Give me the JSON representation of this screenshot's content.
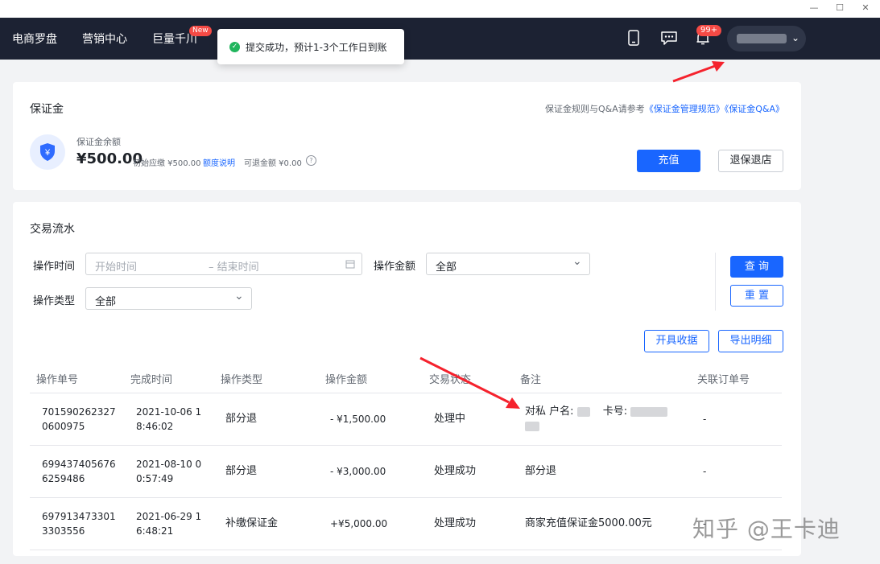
{
  "nav": {
    "items": [
      "电商罗盘",
      "营销中心",
      "巨量千川"
    ],
    "new_badge": "New",
    "notif_count": "99+"
  },
  "toast": {
    "message": "提交成功，预计1-3个工作日到账"
  },
  "deposit": {
    "title": "保证金",
    "rules_prefix": "保证金规则与Q&A请参考",
    "rules_link1": "《保证金管理规范》",
    "rules_link2": "《保证金Q&A》",
    "balance_label": "保证金余额",
    "balance": "¥500.00",
    "initial_due": "初始应缴 ¥500.00",
    "quota_link": "额度说明",
    "refundable": "可退金额 ¥0.00",
    "recharge_button": "充值",
    "refund_button": "退保退店"
  },
  "transactions": {
    "title": "交易流水",
    "filters": {
      "time_label": "操作时间",
      "start_placeholder": "开始时间",
      "end_placeholder": "– 结束时间",
      "amount_label": "操作金额",
      "amount_value": "全部",
      "type_label": "操作类型",
      "type_value": "全部",
      "query_button": "查 询",
      "reset_button": "重 置"
    },
    "receipt_button": "开具收据",
    "export_button": "导出明细",
    "columns": [
      "操作单号",
      "完成时间",
      "操作类型",
      "操作金额",
      "交易状态",
      "备注",
      "关联订单号"
    ],
    "rows": [
      {
        "id_line1": "701590262327",
        "id_line2": "0600975",
        "time_line1": "2021-10-06 1",
        "time_line2": "8:46:02",
        "type": "部分退",
        "amount": "- ¥1,500.00",
        "status": "处理中",
        "note_prefix": "对私 户名:",
        "note_card": "卡号:",
        "order": "-"
      },
      {
        "id_line1": "699437405676",
        "id_line2": "6259486",
        "time_line1": "2021-08-10 0",
        "time_line2": "0:57:49",
        "type": "部分退",
        "amount": "- ¥3,000.00",
        "status": "处理成功",
        "note": "部分退",
        "order": "-"
      },
      {
        "id_line1": "697913473301",
        "id_line2": "3303556",
        "time_line1": "2021-06-29 1",
        "time_line2": "6:48:21",
        "type": "补缴保证金",
        "amount": "+¥5,000.00",
        "status": "处理成功",
        "note": "商家充值保证金5000.00元",
        "order": "-"
      }
    ]
  },
  "watermark": "知乎 @王卡迪",
  "colors": {
    "primary": "#1966ff",
    "nav_bg": "#1c2233",
    "annotation_arrow": "#f5222d",
    "badge": "#f54a45"
  }
}
